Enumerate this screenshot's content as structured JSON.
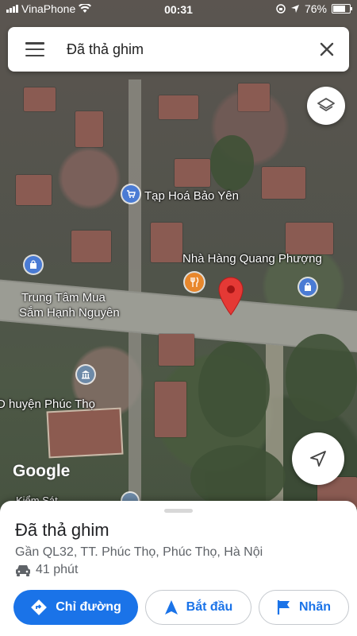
{
  "status_bar": {
    "carrier": "VinaPhone",
    "time": "00:31",
    "battery": "76%"
  },
  "search": {
    "title": "Đã thả ghim"
  },
  "map_labels": {
    "shop1": "Tạp Hoá Bảo Yên",
    "restaurant": "Nhà Hàng Quang Phượng",
    "mall_line1": "Trung Tâm Mua",
    "mall_line2": "Sắm Hạnh Nguyên",
    "district": "D huyện Phúc Thọ",
    "partial": "Kiểm Sát"
  },
  "logo": "Google",
  "sheet": {
    "title": "Đã thả ghim",
    "address": "Gần QL32, TT. Phúc Thọ, Phúc Thọ, Hà Nội",
    "drive_time": "41 phút"
  },
  "buttons": {
    "directions": "Chỉ đường",
    "start": "Bắt đầu",
    "label": "Nhãn"
  },
  "colors": {
    "accent": "#1a73e8",
    "pin": "#e53935"
  },
  "icons": [
    "menu-icon",
    "close-icon",
    "layers-icon",
    "locate-icon",
    "car-icon",
    "directions-icon",
    "navigation-arrow-icon",
    "flag-icon"
  ]
}
